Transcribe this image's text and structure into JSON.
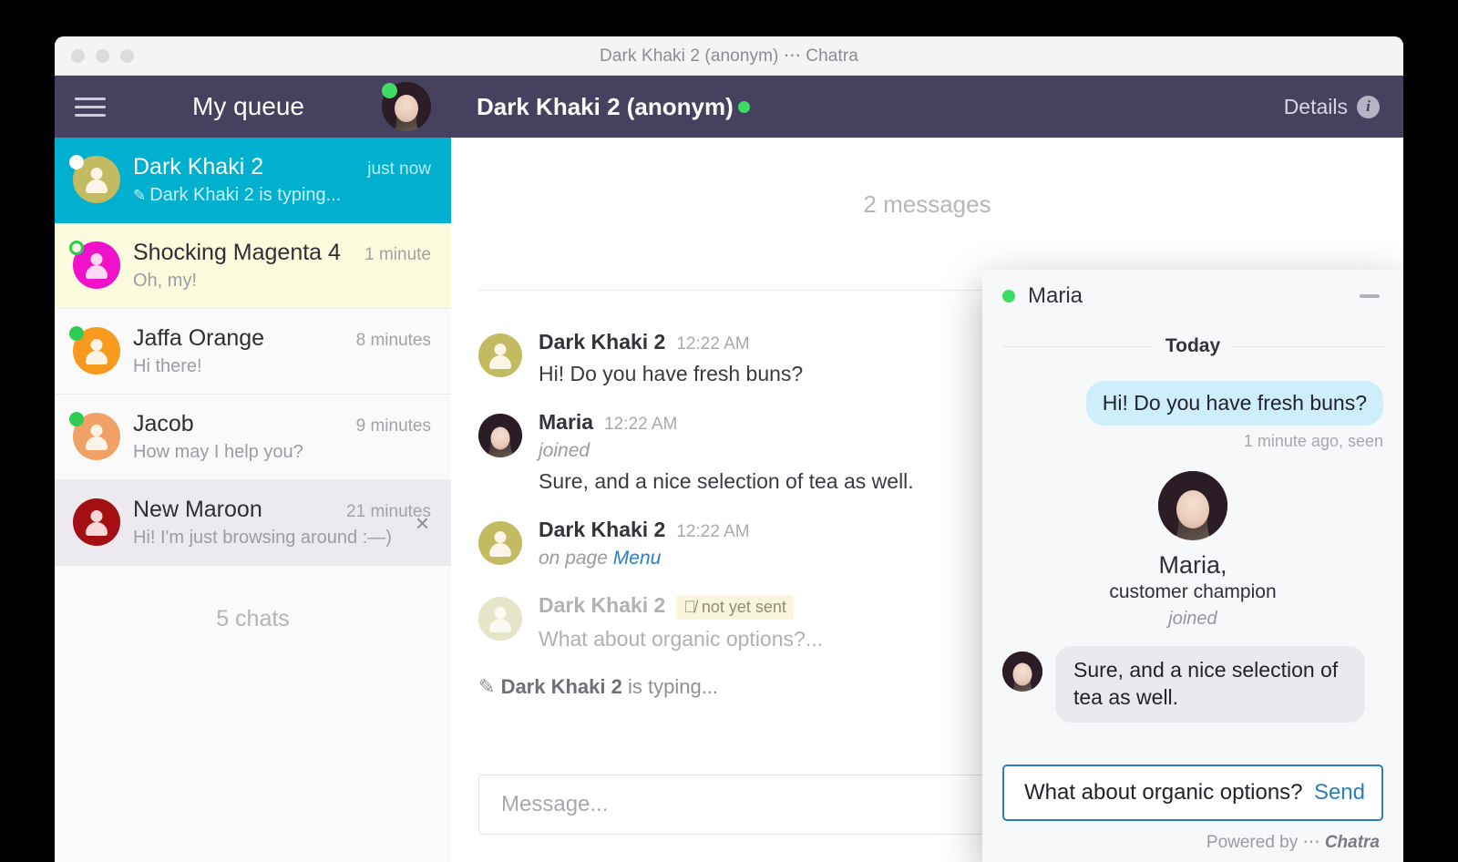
{
  "window": {
    "title": "Dark Khaki 2 (anonym) ⋯ Chatra",
    "traffic_lights": [
      "close",
      "minimize",
      "zoom"
    ]
  },
  "sidebar": {
    "header": {
      "menu_icon": "hamburger-icon",
      "title": "My queue",
      "avatar": "agent-avatar",
      "status": "online"
    },
    "chats": [
      {
        "name": "Dark Khaki 2",
        "time": "just now",
        "preview": "Dark Khaki 2 is typing...",
        "preview_icon": "pencil-icon",
        "state": "active",
        "pip": "white",
        "avatar_color": "#c3bb62"
      },
      {
        "name": "Shocking Magenta 4",
        "time": "1 minute",
        "preview": "Oh, my!",
        "preview_icon": "",
        "state": "unread",
        "pip": "ring",
        "avatar_color": "#f012c8"
      },
      {
        "name": "Jaffa Orange",
        "time": "8 minutes",
        "preview": "Hi there!",
        "preview_icon": "",
        "state": "plain",
        "pip": "green",
        "avatar_color": "#f79a1e"
      },
      {
        "name": "Jacob",
        "time": "9 minutes",
        "preview": "How may I help you?",
        "preview_icon": "",
        "state": "plain",
        "pip": "green",
        "avatar_color": "#f0a266"
      },
      {
        "name": "New Maroon",
        "time": "21 minutes",
        "preview": "Hi! I'm just browsing around :—)",
        "preview_icon": "",
        "state": "hovered",
        "pip": "none",
        "avatar_color": "#a30f12"
      }
    ],
    "close_icon": "close-icon",
    "chat_count": "5 chats"
  },
  "conversation": {
    "header": {
      "title": "Dark Khaki 2 (anonym)",
      "status": "online",
      "details_label": "Details",
      "details_icon": "info-icon"
    },
    "message_count": "2 messages",
    "day_separator": "Today",
    "messages": [
      {
        "author": "Dark Khaki 2",
        "time": "12:22 AM",
        "meta": "",
        "text": "Hi! Do you have fresh buns?",
        "avatar_color": "#c3bb62",
        "kind": "visitor"
      },
      {
        "author": "Maria",
        "time": "12:22 AM",
        "meta": "joined",
        "text": "Sure, and a nice selection of tea as well.",
        "avatar_color": "",
        "kind": "agent"
      },
      {
        "author": "Dark Khaki 2",
        "time": "12:22 AM",
        "meta": "on page",
        "meta_link": "Menu",
        "text": "",
        "avatar_color": "#c3bb62",
        "kind": "visitor"
      },
      {
        "author": "Dark Khaki 2",
        "time": "",
        "badge": "not yet sent",
        "badge_icon": "eye-off-icon",
        "text": "What about organic options?...",
        "avatar_color": "#e7e5c9",
        "kind": "pending"
      }
    ],
    "typing_author": "Dark Khaki 2",
    "typing_suffix": "is typing...",
    "typing_icon": "pencil-icon",
    "composer_placeholder": "Message..."
  },
  "widget": {
    "header": {
      "name": "Maria",
      "status": "online",
      "minimize_icon": "minimize-icon"
    },
    "day_separator": "Today",
    "outgoing": {
      "text": "Hi! Do you have fresh buns?",
      "status": "1 minute ago, seen"
    },
    "agent_card": {
      "name": "Maria,",
      "role": "customer champion",
      "action": "joined",
      "photo": "agent-photo"
    },
    "incoming": {
      "text": "Sure, and a nice selection of tea as well.",
      "photo": "agent-photo"
    },
    "input": {
      "value": "What about organic options?",
      "send_label": "Send"
    },
    "powered_by": {
      "prefix": "Powered by",
      "dots": "⋯",
      "brand": "Chatra"
    }
  },
  "colors": {
    "header_purple": "#45415f",
    "active_cyan": "#00b0ce",
    "unread_yellow": "#fcfbdd",
    "link_blue": "#2a7fbe",
    "online_green": "#3ddc62",
    "bubble_out": "#cfeefb",
    "bubble_in": "#e9eaee"
  }
}
